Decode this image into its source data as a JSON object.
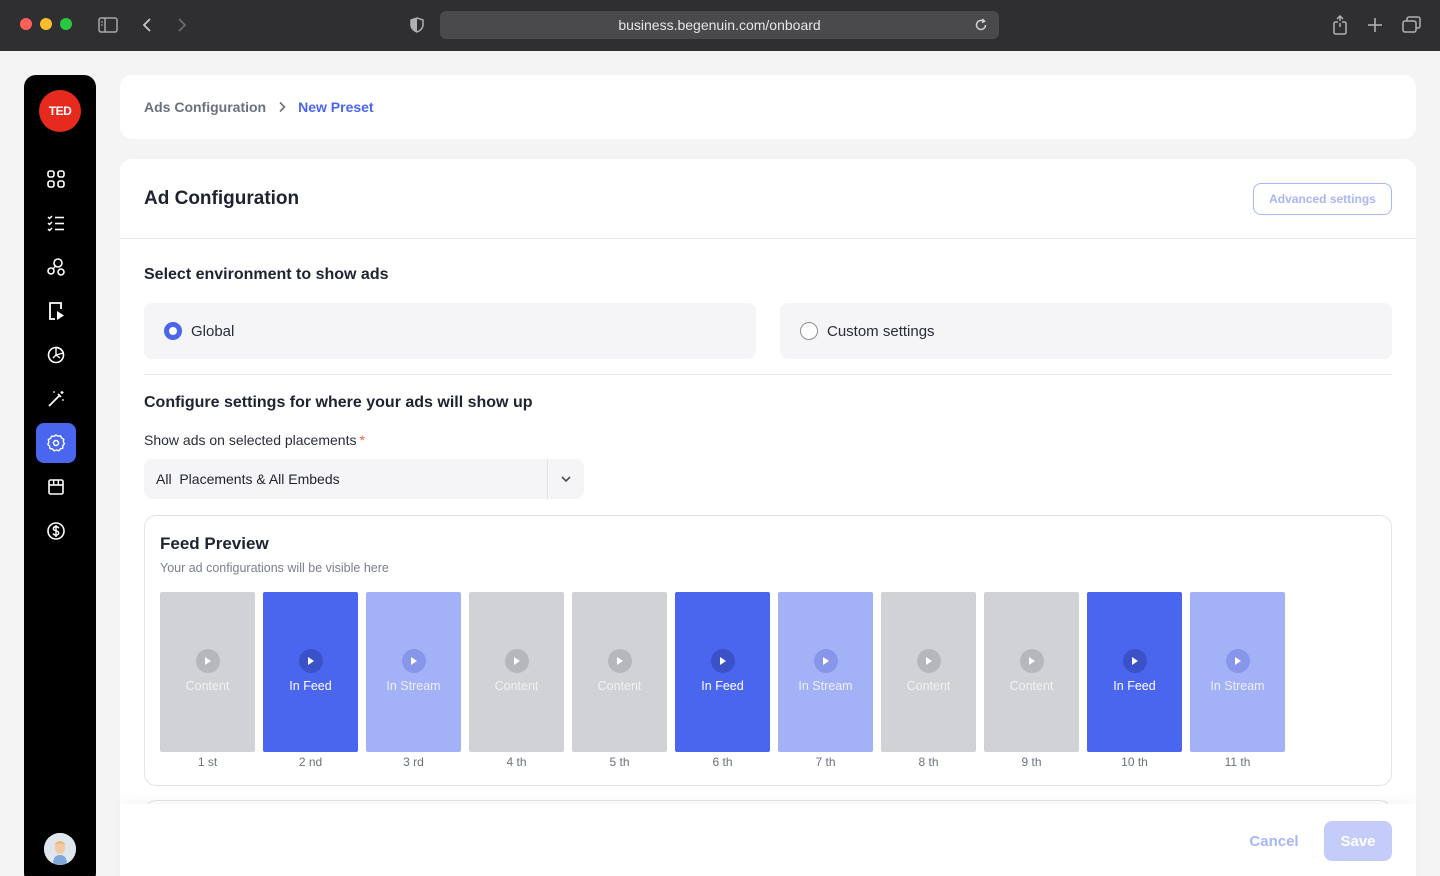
{
  "browser": {
    "url": "business.begenuin.com/onboard"
  },
  "sidebar": {
    "logo": "TED",
    "items": [
      {
        "icon": "grid-icon"
      },
      {
        "icon": "checklist-icon"
      },
      {
        "icon": "community-icon"
      },
      {
        "icon": "video-file-icon"
      },
      {
        "icon": "analytics-icon"
      },
      {
        "icon": "magic-wand-icon"
      },
      {
        "icon": "gear-icon",
        "active": true
      },
      {
        "icon": "store-icon"
      },
      {
        "icon": "dollar-icon"
      }
    ]
  },
  "breadcrumb": {
    "parent": "Ads Configuration",
    "current": "New Preset"
  },
  "card": {
    "title": "Ad Configuration",
    "advanced_label": "Advanced settings"
  },
  "environment": {
    "title": "Select environment to show ads",
    "options": [
      {
        "label": "Global",
        "selected": true
      },
      {
        "label": "Custom settings",
        "selected": false
      }
    ]
  },
  "placements": {
    "section_title": "Configure settings for where your ads will show up",
    "field_label": "Show ads on selected placements",
    "required_mark": "*",
    "selected_value": "All  Placements & All Embeds"
  },
  "feed_preview": {
    "title": "Feed Preview",
    "subtitle": "Your ad configurations will be visible here",
    "tiles": [
      {
        "type": "content",
        "label": "Content",
        "position": "1 st"
      },
      {
        "type": "infeed",
        "label": "In Feed",
        "position": "2 nd"
      },
      {
        "type": "instream",
        "label": "In Stream",
        "position": "3 rd"
      },
      {
        "type": "content",
        "label": "Content",
        "position": "4 th"
      },
      {
        "type": "content",
        "label": "Content",
        "position": "5 th"
      },
      {
        "type": "infeed",
        "label": "In Feed",
        "position": "6 th"
      },
      {
        "type": "instream",
        "label": "In Stream",
        "position": "7 th"
      },
      {
        "type": "content",
        "label": "Content",
        "position": "8 th"
      },
      {
        "type": "content",
        "label": "Content",
        "position": "9 th"
      },
      {
        "type": "infeed",
        "label": "In Feed",
        "position": "10 th"
      },
      {
        "type": "instream",
        "label": "In Stream",
        "position": "11 th"
      }
    ]
  },
  "footer": {
    "cancel_label": "Cancel",
    "save_label": "Save"
  },
  "colors": {
    "accent": "#4b66ee",
    "in_stream": "#a3b1f7",
    "content": "#d0d2d6",
    "logo": "#e62b1e"
  }
}
